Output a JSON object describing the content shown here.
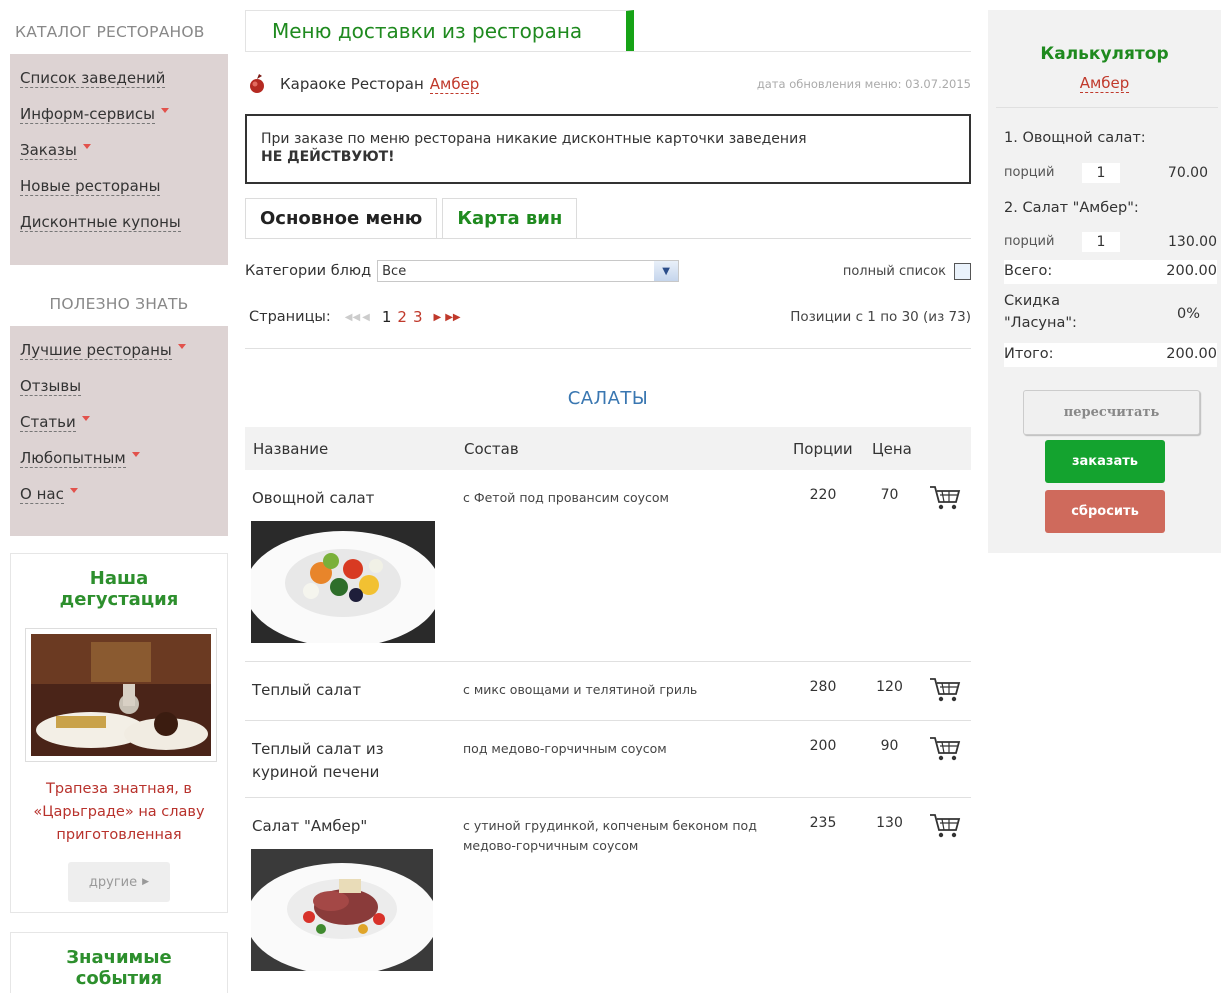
{
  "sidebar": {
    "catalog": {
      "title": "КАТАЛОГ РЕСТОРАНОВ",
      "items": [
        {
          "label": "Список заведений",
          "caret": false
        },
        {
          "label": "Информ-сервисы",
          "caret": true
        },
        {
          "label": "Заказы",
          "caret": true
        },
        {
          "label": "Новые рестораны",
          "caret": false
        },
        {
          "label": "Дисконтные купоны",
          "caret": false
        }
      ]
    },
    "useful": {
      "title": "ПОЛЕЗНО ЗНАТЬ",
      "items": [
        {
          "label": "Лучшие рестораны",
          "caret": true
        },
        {
          "label": "Отзывы",
          "caret": false
        },
        {
          "label": "Статьи",
          "caret": true
        },
        {
          "label": "Любопытным",
          "caret": true
        },
        {
          "label": "О нас",
          "caret": true
        }
      ]
    },
    "tasting": {
      "title": "Наша дегустация",
      "caption": "Трапеза знатная, в «Царьграде» на славу приготовленная",
      "more_label": "другие"
    },
    "events": {
      "title": "Значимые события"
    }
  },
  "main": {
    "tab_title": "Меню доставки из ресторана",
    "restaurant_prefix": "Караоке Ресторан",
    "restaurant_name": "Амбер",
    "update_date": "дата обновления меню: 03.07.2015",
    "notice_line1": "При заказе по меню ресторана никакие дисконтные карточки заведения",
    "notice_line2": "НЕ ДЕЙСТВУЮТ!",
    "tabs": [
      {
        "label": "Основное меню",
        "active": true
      },
      {
        "label": "Карта вин",
        "active": false
      }
    ],
    "categories_label": "Категории блюд",
    "categories_value": "Все",
    "full_list_label": "полный список",
    "pages_label": "Страницы:",
    "pages": [
      "1",
      "2",
      "3"
    ],
    "positions_text": "Позиции с 1 по 30 (из 73)",
    "category_title": "САЛАТЫ",
    "columns": {
      "name": "Название",
      "composition": "Состав",
      "portions": "Порции",
      "price": "Цена"
    },
    "dishes": [
      {
        "name": "Овощной салат",
        "composition": "с Фетой под провансим соусом",
        "portions": "220",
        "price": "70",
        "has_image": true
      },
      {
        "name": "Теплый салат",
        "composition": "с микс овощами и телятиной гриль",
        "portions": "280",
        "price": "120",
        "has_image": false
      },
      {
        "name": "Теплый салат из куриной печени",
        "composition": "под медово-горчичным соусом",
        "portions": "200",
        "price": "90",
        "has_image": false
      },
      {
        "name": "Салат \"Амбер\"",
        "composition": "с утиной грудинкой, копченым беконом под медово-горчичным соусом",
        "portions": "235",
        "price": "130",
        "has_image": true
      }
    ]
  },
  "calculator": {
    "title": "Калькулятор",
    "restaurant": "Амбер",
    "items": [
      {
        "label": "1. Овощной салат:",
        "qty_label": "порций",
        "qty": "1",
        "amount": "70.00"
      },
      {
        "label": "2. Салат \"Амбер\":",
        "qty_label": "порций",
        "qty": "1",
        "amount": "130.00"
      }
    ],
    "total_label": "Всего:",
    "total_value": "200.00",
    "discount_label_1": "Скидка",
    "discount_label_2": "\"Ласуна\":",
    "discount_value": "0%",
    "result_label": "Итого:",
    "result_value": "200.00",
    "recalc_label": "пересчитать",
    "order_label": "заказать",
    "reset_label": "сбросить"
  },
  "colors": {
    "accent_green": "#1f8a1f",
    "order_green": "#14a32f",
    "reset_red": "#cf6a5c",
    "link_red": "#c0392b",
    "title_blue": "#3a77b1"
  }
}
